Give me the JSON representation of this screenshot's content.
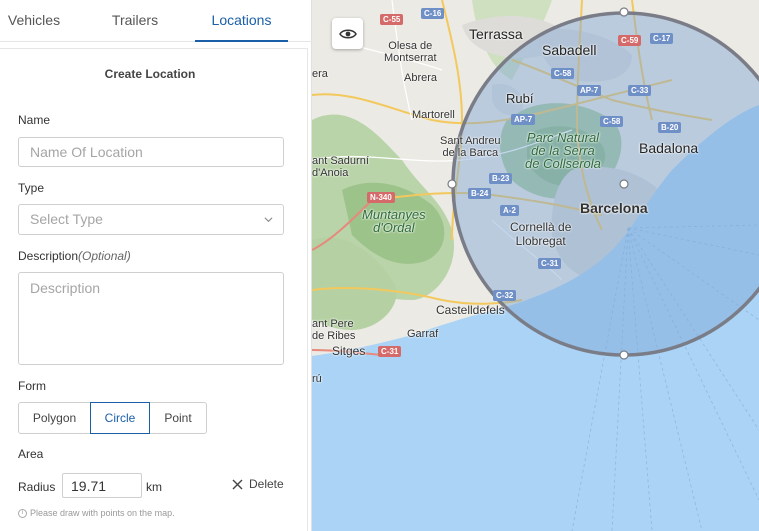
{
  "tabs": [
    {
      "label": "Vehicles",
      "active": false
    },
    {
      "label": "Trailers",
      "active": false
    },
    {
      "label": "Locations",
      "active": true
    }
  ],
  "form": {
    "title": "Create Location",
    "name": {
      "label": "Name",
      "placeholder": "Name Of Location",
      "value": ""
    },
    "type": {
      "label": "Type",
      "placeholder": "Select Type"
    },
    "description": {
      "label": "Description",
      "optional": "(Optional)",
      "placeholder": "Description",
      "value": ""
    },
    "shape": {
      "label": "Form",
      "options": [
        "Polygon",
        "Circle",
        "Point"
      ],
      "selected": "Circle"
    },
    "area": {
      "label": "Area",
      "radius_label": "Radius",
      "radius_value": "19.71",
      "unit": "km",
      "delete_label": "Delete"
    },
    "hint": "Please draw with points on the map."
  },
  "map": {
    "places": {
      "terrassa": "Terrassa",
      "sabadell": "Sabadell",
      "olesa": "Olesa de\nMontserrat",
      "abrera": "Abrera",
      "rubi": "Rubí",
      "martorell": "Martorell",
      "santandreu": "Sant Andreu\nde la Barca",
      "collserola": "Parc Natural\nde la Serra\nde Collserola",
      "badalona": "Badalona",
      "santsadurni": "ant Sadurní\nd'Anoia",
      "barcelona": "Barcelona",
      "ordal": "Muntanyes\nd'Ordal",
      "cornella": "Cornellà de\nLlobregat",
      "castelldefels": "Castelldefels",
      "garraf": "Garraf",
      "santpere": "ant Pere\nde Ribes",
      "sitges": "Sitges",
      "cru": "rú",
      "era": "era"
    },
    "roads": [
      "C-55",
      "C-16",
      "C-59",
      "C-17",
      "C-58",
      "AP-7",
      "C-33",
      "AP-7",
      "C-58",
      "B-20",
      "B-23",
      "B-24",
      "N-340",
      "A-2",
      "C-31",
      "C-32",
      "C-31"
    ],
    "colors": {
      "accent": "#1a5fa8",
      "sea": "#aad3f5",
      "circle_fill": "#7fa6d6",
      "circle_stroke": "#7a7d87"
    }
  },
  "icons": {
    "eye": "eye-icon",
    "chevron": "chevron-down-icon",
    "close": "close-icon",
    "info": "info-icon"
  }
}
